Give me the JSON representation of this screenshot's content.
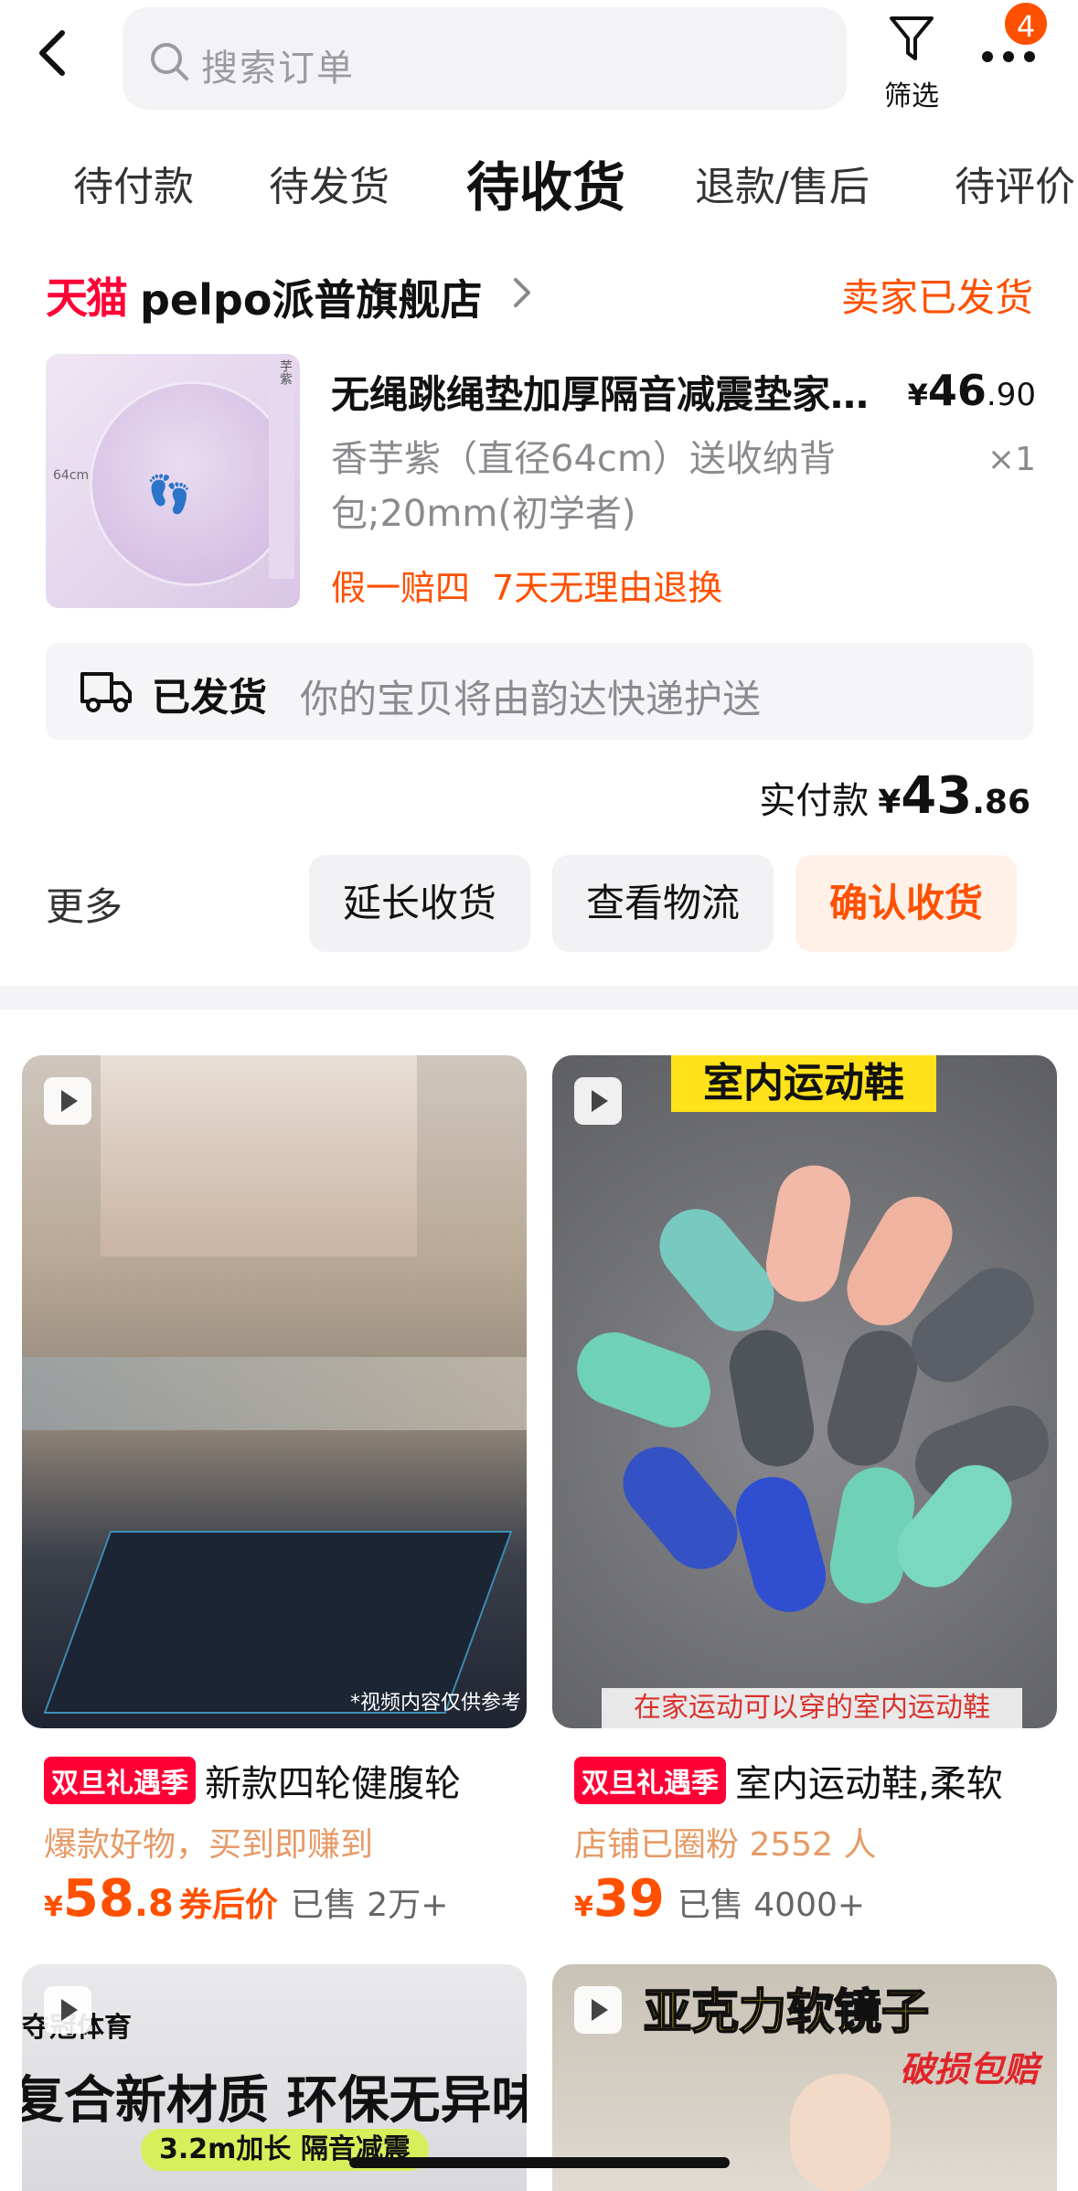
{
  "header": {
    "search_placeholder": "搜索订单",
    "filter_label": "筛选",
    "more_badge": "4"
  },
  "tabs": [
    {
      "label": "待付款",
      "active": false
    },
    {
      "label": "待发货",
      "active": false
    },
    {
      "label": "待收货",
      "active": true
    },
    {
      "label": "退款/售后",
      "active": false
    },
    {
      "label": "待评价",
      "active": false
    }
  ],
  "order": {
    "store_brand": "天猫",
    "store_name": "pelpo派普旗舰店",
    "status": "卖家已发货",
    "product": {
      "title": "无绳跳绳垫加厚隔音减震垫家...",
      "price_currency": "¥",
      "price_int": "46",
      "price_dec": ".90",
      "spec": "香芋紫（直径64cm）送收纳背包;20mm(初学者)",
      "qty": "×1",
      "tags": [
        "假一赔四",
        "7天无理由退换"
      ],
      "image_dim_text": "64cm",
      "image_side_text": "芋紫"
    },
    "shipping": {
      "status": "已发货",
      "message": "你的宝贝将由韵达快递护送"
    },
    "paid": {
      "label": "实付款",
      "currency": "¥",
      "int": "43",
      "dec": ".86"
    },
    "actions": {
      "more": "更多",
      "extend": "延长收货",
      "logistics": "查看物流",
      "confirm": "确认收货"
    }
  },
  "recommendations": [
    {
      "promo": "双旦礼遇季",
      "title": "新款四轮健腹轮",
      "subtitle": "爆款好物，买到即赚到",
      "price_currency": "¥",
      "price_int": "58",
      "price_dec": ".8",
      "coupon_label": "券后价",
      "sold": "已售 2万+",
      "image_note": "*视频内容仅供参考"
    },
    {
      "promo": "双旦礼遇季",
      "title": "室内运动鞋,柔软",
      "subtitle": "店铺已圈粉 2552 人",
      "price_currency": "¥",
      "price_int": "39",
      "price_dec": "",
      "coupon_label": "",
      "sold": "已售 4000+",
      "image_banner": "室内运动鞋",
      "image_caption": "在家运动可以穿的室内运动鞋"
    },
    {
      "image_text_1": "夺冠体育",
      "image_text_2": "复合新材质  环保无异味",
      "image_text_3": "3.2m加长 隔音减震"
    },
    {
      "image_text_1": "亚克力软镜子",
      "image_text_2": "破损包赔"
    }
  ],
  "colors": {
    "accent": "#ff5000",
    "tmall_red": "#ff0036",
    "muted_text": "#8a8a8f"
  }
}
